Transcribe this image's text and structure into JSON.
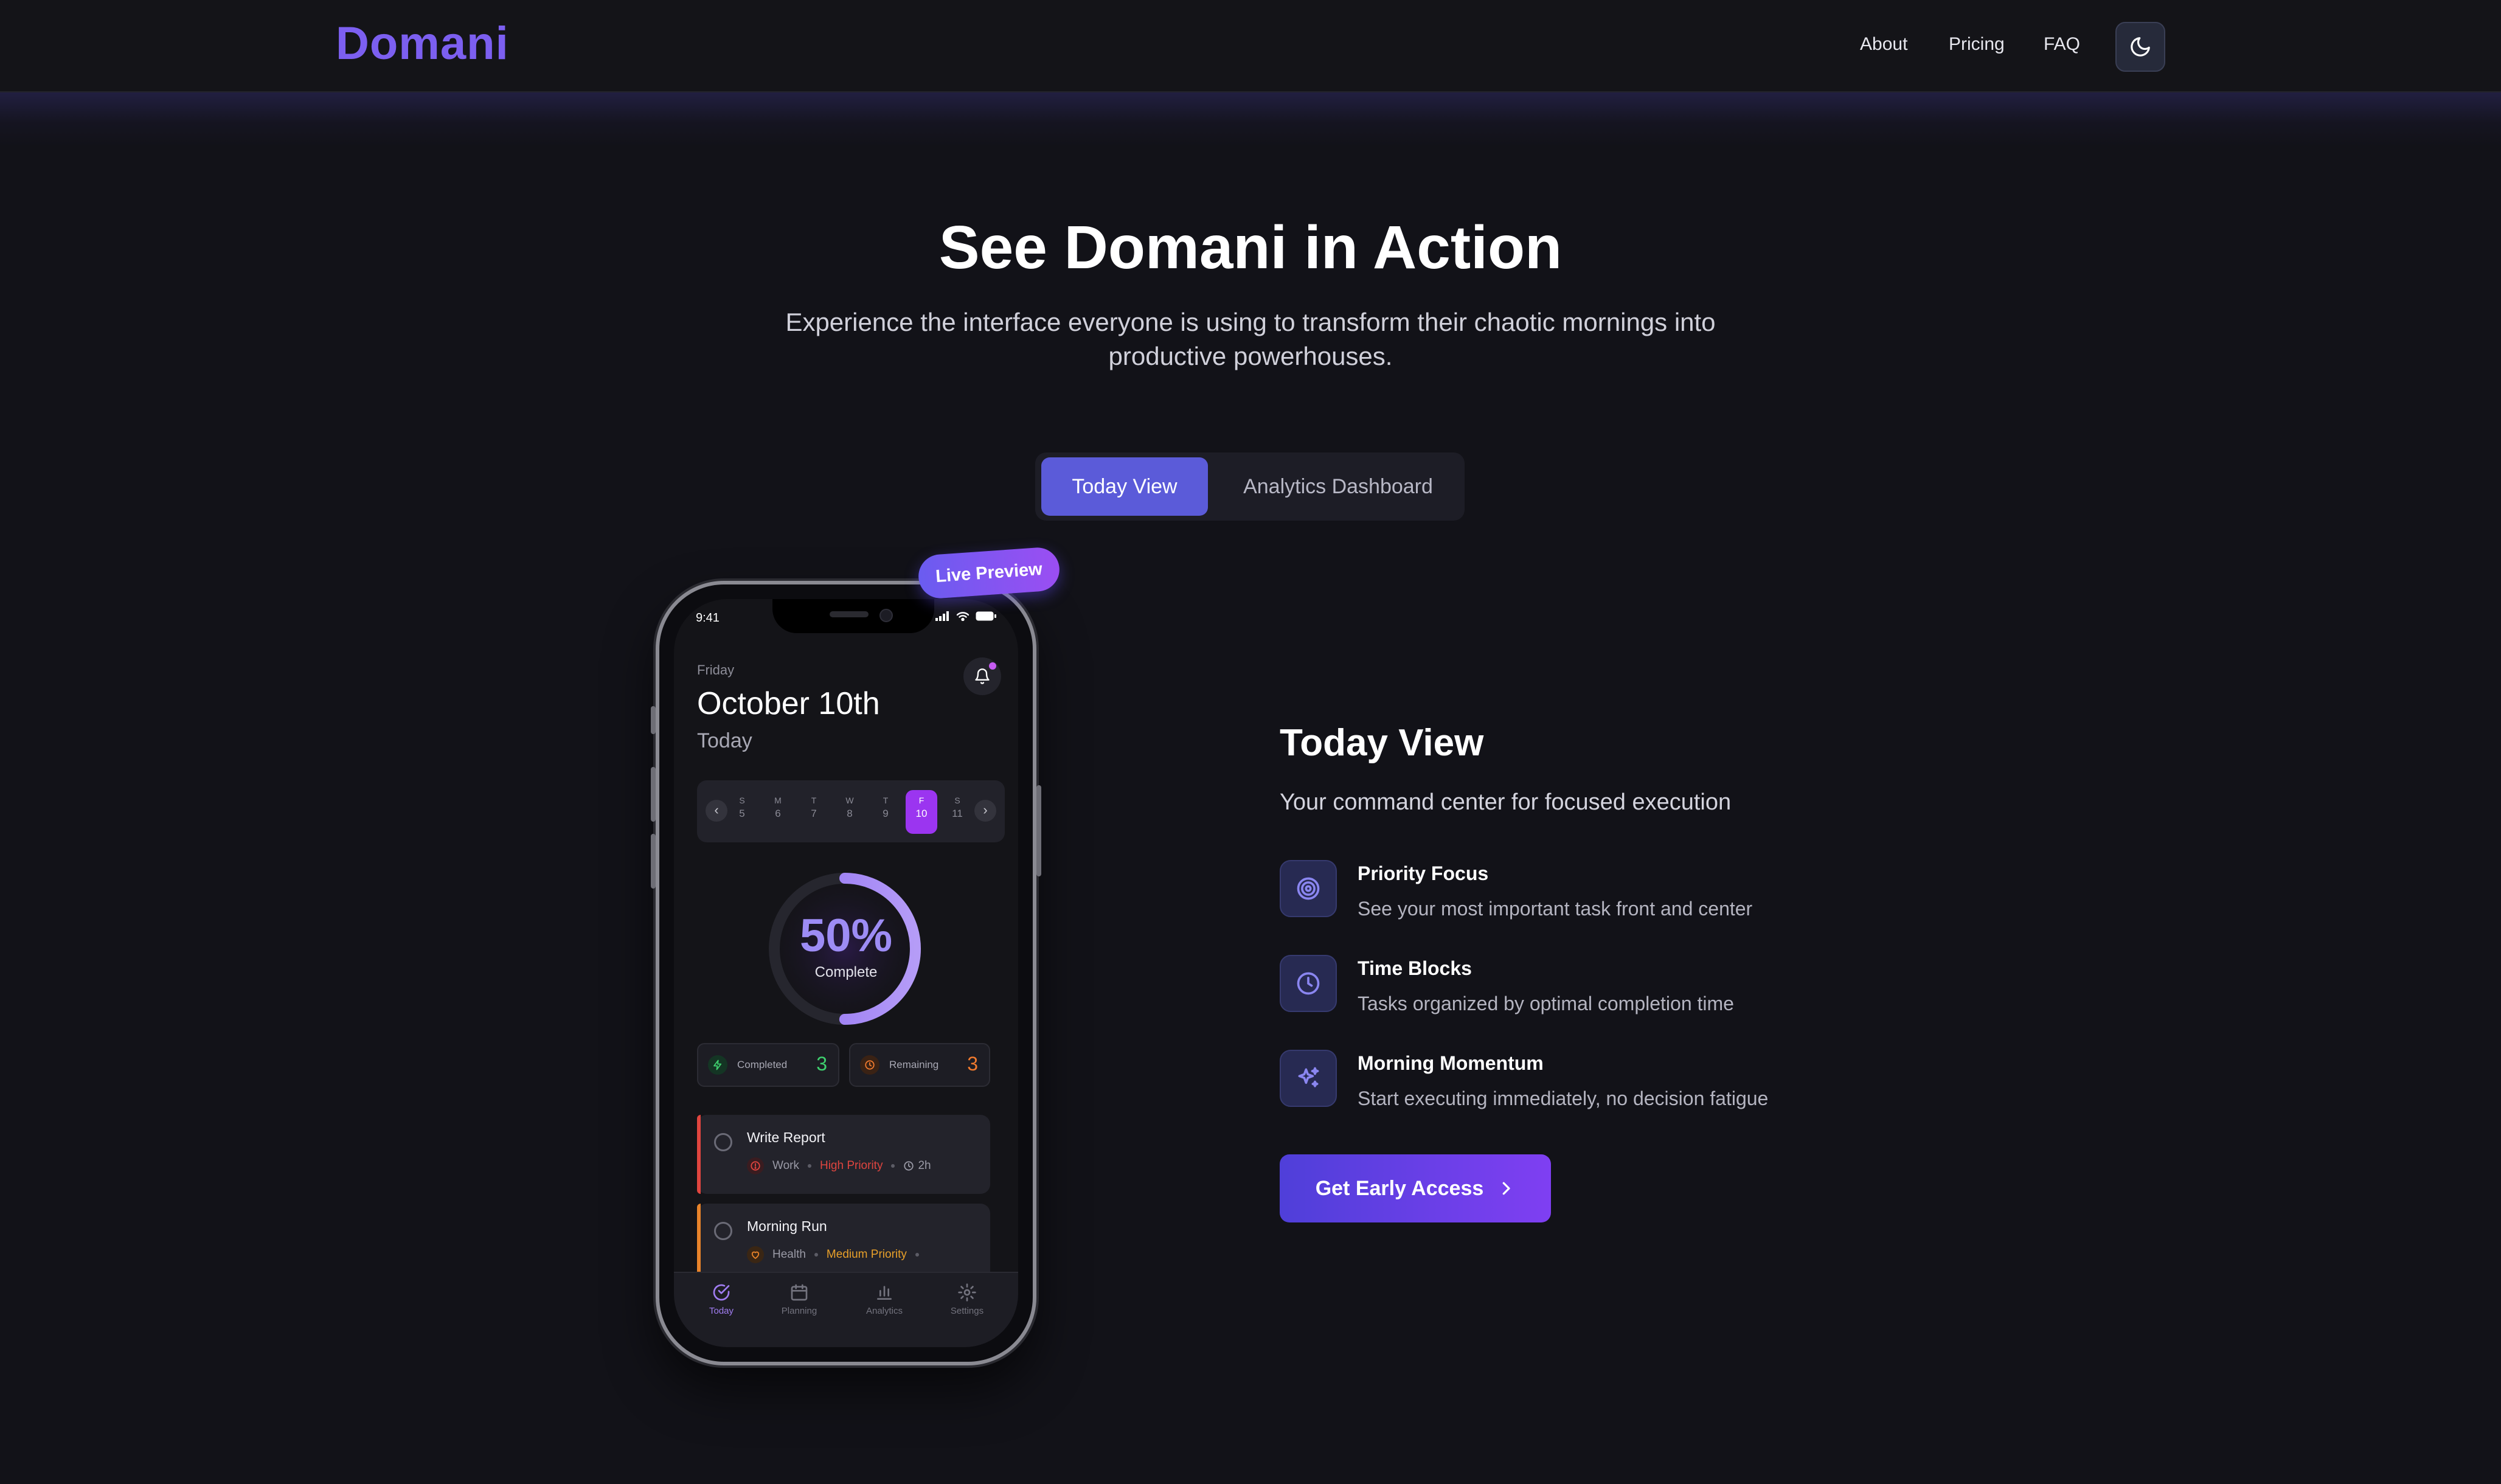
{
  "nav": {
    "logo": "Domani",
    "links": [
      "About",
      "Pricing",
      "FAQ"
    ],
    "theme_toggle_icon": "moon-icon"
  },
  "hero": {
    "title": "See Domani in Action",
    "subtitle": "Experience the interface everyone is using to transform their chaotic mornings into productive powerhouses."
  },
  "tabs": [
    {
      "label": "Today View",
      "active": true
    },
    {
      "label": "Analytics Dashboard",
      "active": false
    }
  ],
  "badge": "Live Preview",
  "phone": {
    "status_time": "9:41",
    "day": "Friday",
    "date": "October 10th",
    "subtitle": "Today",
    "week": [
      {
        "letter": "S",
        "num": "5"
      },
      {
        "letter": "M",
        "num": "6"
      },
      {
        "letter": "T",
        "num": "7"
      },
      {
        "letter": "W",
        "num": "8"
      },
      {
        "letter": "T",
        "num": "9"
      },
      {
        "letter": "F",
        "num": "10",
        "selected": true
      },
      {
        "letter": "S",
        "num": "11"
      }
    ],
    "progress": {
      "percent_text": "50%",
      "fraction": 0.5,
      "label": "Complete"
    },
    "stats": {
      "completed": {
        "label": "Completed",
        "value": "3",
        "color": "#3ecf6e"
      },
      "remaining": {
        "label": "Remaining",
        "value": "3",
        "color": "#f07a2e"
      }
    },
    "tasks": [
      {
        "title": "Write Report",
        "category": "Work",
        "priority": "High Priority",
        "duration": "2h",
        "accent": "#e0453f"
      },
      {
        "title": "Morning Run",
        "category": "Health",
        "priority": "Medium Priority",
        "duration": "",
        "accent": "#e8832a"
      }
    ],
    "tabbar": [
      "Today",
      "Planning",
      "Analytics",
      "Settings"
    ]
  },
  "feature_panel": {
    "title": "Today View",
    "subtitle": "Your command center for focused execution",
    "features": [
      {
        "icon": "target-icon",
        "title": "Priority Focus",
        "desc": "See your most important task front and center"
      },
      {
        "icon": "clock-icon",
        "title": "Time Blocks",
        "desc": "Tasks organized by optimal completion time"
      },
      {
        "icon": "sparkles-icon",
        "title": "Morning Momentum",
        "desc": "Start executing immediately, no decision fatigue"
      }
    ],
    "cta": "Get Early Access"
  },
  "colors": {
    "brand": "#7c5ff0",
    "accent": "#5b5bd9",
    "background": "#121218"
  }
}
